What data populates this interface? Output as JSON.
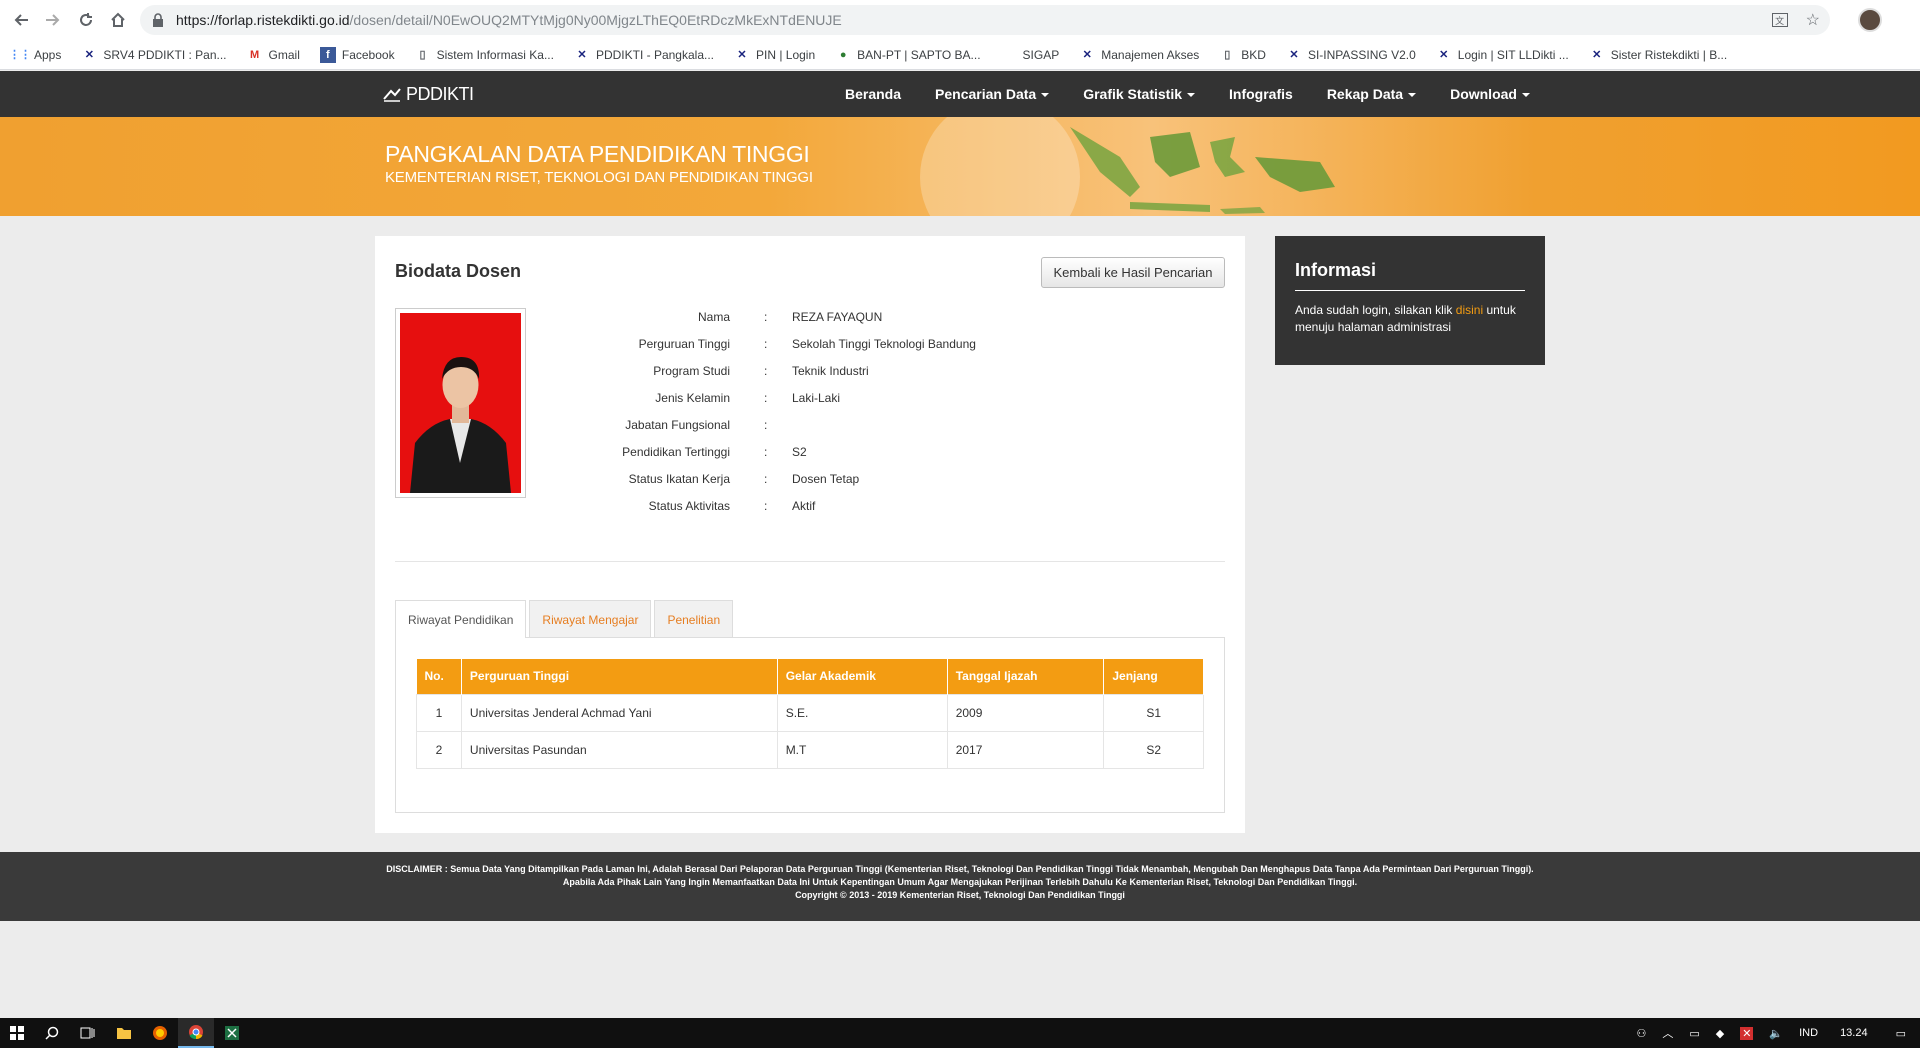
{
  "browser": {
    "url_host": "https://forlap.ristekdikti.go.id",
    "url_path": "/dosen/detail/N0EwOUQ2MTYtMjg0Ny00MjgzLThEQ0EtRDczMkExNTdENUJE",
    "bookmarks": [
      {
        "label": "Apps",
        "icon": "apps-grid-icon",
        "color": "#4285f4"
      },
      {
        "label": "SRV4 PDDIKTI : Pan...",
        "icon": "pddikti-icon",
        "color": "#1a237e"
      },
      {
        "label": "Gmail",
        "icon": "gmail-icon",
        "color": "#d93025"
      },
      {
        "label": "Facebook",
        "icon": "facebook-icon",
        "color": "#3b5998"
      },
      {
        "label": "Sistem Informasi Ka...",
        "icon": "page-icon",
        "color": "#5f6368"
      },
      {
        "label": "PDDIKTI - Pangkala...",
        "icon": "pddikti-icon",
        "color": "#1a237e"
      },
      {
        "label": "PIN | Login",
        "icon": "pddikti-icon",
        "color": "#1a237e"
      },
      {
        "label": "BAN-PT | SAPTO BA...",
        "icon": "banpt-icon",
        "color": "#2e7d32"
      },
      {
        "label": "SIGAP",
        "icon": "blank-icon",
        "color": "#ffffff"
      },
      {
        "label": "Manajemen Akses",
        "icon": "pddikti-icon",
        "color": "#1a237e"
      },
      {
        "label": "BKD",
        "icon": "page-icon",
        "color": "#5f6368"
      },
      {
        "label": "SI-INPASSING V2.0",
        "icon": "pddikti-icon",
        "color": "#1a237e"
      },
      {
        "label": "Login | SIT LLDikti ...",
        "icon": "pddikti-icon",
        "color": "#1a237e"
      },
      {
        "label": "Sister Ristekdikti | B...",
        "icon": "pddikti-icon",
        "color": "#1a237e"
      }
    ]
  },
  "site": {
    "logo": "PDDIKTI",
    "menu": [
      {
        "label": "Beranda",
        "dropdown": false
      },
      {
        "label": "Pencarian Data",
        "dropdown": true
      },
      {
        "label": "Grafik Statistik",
        "dropdown": true
      },
      {
        "label": "Infografis",
        "dropdown": false
      },
      {
        "label": "Rekap Data",
        "dropdown": true
      },
      {
        "label": "Download",
        "dropdown": true
      }
    ],
    "banner_title": "PANGKALAN DATA PENDIDIKAN TINGGI",
    "banner_subtitle": "KEMENTERIAN RISET, TEKNOLOGI DAN PENDIDIKAN TINGGI"
  },
  "main": {
    "title": "Biodata Dosen",
    "back_button": "Kembali ke Hasil Pencarian",
    "biodata": [
      {
        "label": "Nama",
        "value": "REZA FAYAQUN"
      },
      {
        "label": "Perguruan Tinggi",
        "value": "Sekolah Tinggi Teknologi Bandung"
      },
      {
        "label": "Program Studi",
        "value": "Teknik Industri"
      },
      {
        "label": "Jenis Kelamin",
        "value": "Laki-Laki"
      },
      {
        "label": "Jabatan Fungsional",
        "value": ""
      },
      {
        "label": "Pendidikan Tertinggi",
        "value": "S2"
      },
      {
        "label": "Status Ikatan Kerja",
        "value": "Dosen Tetap"
      },
      {
        "label": "Status Aktivitas",
        "value": "Aktif"
      }
    ],
    "tabs": [
      "Riwayat Pendidikan",
      "Riwayat Mengajar",
      "Penelitian"
    ],
    "table": {
      "headers": [
        "No.",
        "Perguruan Tinggi",
        "Gelar Akademik",
        "Tanggal Ijazah",
        "Jenjang"
      ],
      "rows": [
        [
          "1",
          "Universitas Jenderal Achmad Yani",
          "S.E.",
          "2009",
          "S1"
        ],
        [
          "2",
          "Universitas Pasundan",
          "M.T",
          "2017",
          "S2"
        ]
      ]
    }
  },
  "info": {
    "title": "Informasi",
    "text_before": "Anda sudah login, silakan klik ",
    "link": "disini",
    "text_after": " untuk menuju halaman administrasi"
  },
  "footer": {
    "line1": "DISCLAIMER : Semua Data Yang Ditampilkan Pada Laman Ini, Adalah Berasal Dari Pelaporan Data Perguruan Tinggi (Kementerian Riset, Teknologi Dan Pendidikan Tinggi Tidak Menambah, Mengubah Dan Menghapus Data Tanpa Ada Permintaan Dari Perguruan Tinggi).",
    "line2": "Apabila Ada Pihak Lain Yang Ingin Memanfaatkan Data Ini Untuk Kepentingan Umum Agar Mengajukan Perijinan Terlebih Dahulu Ke Kementerian Riset, Teknologi Dan Pendidikan Tinggi.",
    "line3": "Copyright © 2013 - 2019 Kementerian Riset, Teknologi Dan Pendidikan Tinggi"
  },
  "taskbar": {
    "language": "IND",
    "time": "13.24"
  },
  "colors": {
    "accent": "#f39c12",
    "nav": "#333333",
    "link": "#e67e22"
  }
}
